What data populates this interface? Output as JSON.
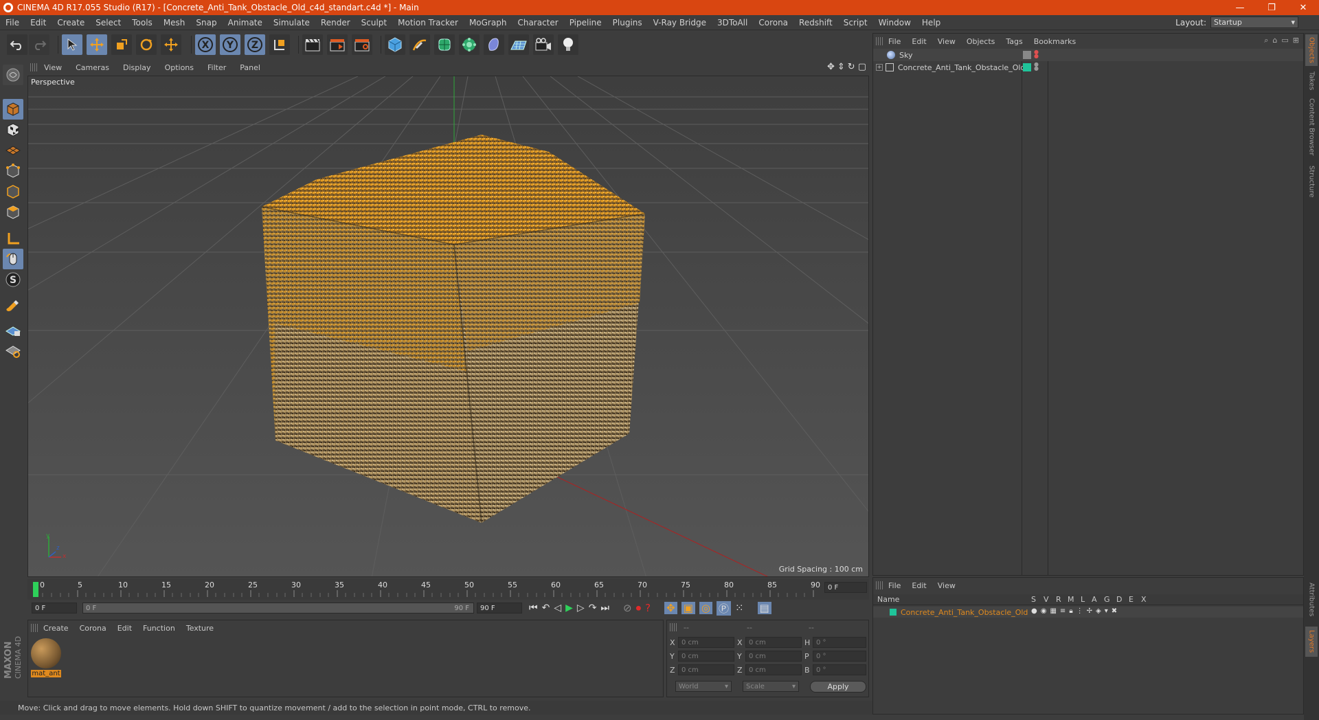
{
  "window": {
    "title": "CINEMA 4D R17.055 Studio (R17) - [Concrete_Anti_Tank_Obstacle_Old_c4d_standart.c4d *] - Main",
    "controls": [
      "—",
      "❐",
      "✕"
    ]
  },
  "menu": [
    "File",
    "Edit",
    "Create",
    "Select",
    "Tools",
    "Mesh",
    "Snap",
    "Animate",
    "Simulate",
    "Render",
    "Sculpt",
    "Motion Tracker",
    "MoGraph",
    "Character",
    "Pipeline",
    "Plugins",
    "V-Ray Bridge",
    "3DToAll",
    "Corona",
    "Redshift",
    "Script",
    "Window",
    "Help"
  ],
  "layout": {
    "label": "Layout:",
    "value": "Startup"
  },
  "viewport": {
    "menu": [
      "View",
      "Cameras",
      "Display",
      "Options",
      "Filter",
      "Panel"
    ],
    "label": "Perspective",
    "grid_spacing": "Grid Spacing : 100 cm",
    "axis": {
      "y": "y",
      "z": "z",
      "x": "x"
    }
  },
  "objects_panel": {
    "menu": [
      "File",
      "Edit",
      "View",
      "Objects",
      "Tags",
      "Bookmarks"
    ],
    "items": [
      {
        "name": "Sky"
      },
      {
        "name": "Concrete_Anti_Tank_Obstacle_Old"
      }
    ]
  },
  "side_tabs": [
    "Objects",
    "Takes",
    "Content Browser",
    "Structure",
    "Attributes",
    "Layers"
  ],
  "timeline": {
    "ticks": [
      "0",
      "5",
      "10",
      "15",
      "20",
      "25",
      "30",
      "35",
      "40",
      "45",
      "50",
      "55",
      "60",
      "65",
      "70",
      "75",
      "80",
      "85",
      "90"
    ],
    "current_frame": "0 F",
    "start": "0 F",
    "range_start": "0 F",
    "range_end": "90 F",
    "end": "90 F"
  },
  "material_panel": {
    "menu": [
      "Create",
      "Corona",
      "Edit",
      "Function",
      "Texture"
    ],
    "materials": [
      {
        "name": "mat_ant"
      }
    ]
  },
  "coord_panel": {
    "headers": [
      "--",
      "--",
      "--"
    ],
    "rows": [
      {
        "a": "X",
        "av": "0 cm",
        "b": "X",
        "bv": "0 cm",
        "c": "H",
        "cv": "0 °"
      },
      {
        "a": "Y",
        "av": "0 cm",
        "b": "Y",
        "bv": "0 cm",
        "c": "P",
        "cv": "0 °"
      },
      {
        "a": "Z",
        "av": "0 cm",
        "b": "Z",
        "bv": "0 cm",
        "c": "B",
        "cv": "0 °"
      }
    ],
    "mode1": "World",
    "mode2": "Scale",
    "apply": "Apply"
  },
  "layer_panel": {
    "menu": [
      "File",
      "Edit",
      "View"
    ],
    "columns": [
      "Name",
      "S",
      "V",
      "R",
      "M",
      "L",
      "A",
      "G",
      "D",
      "E",
      "X"
    ],
    "items": [
      {
        "name": "Concrete_Anti_Tank_Obstacle_Old"
      }
    ]
  },
  "status": "Move: Click and drag to move elements. Hold down SHIFT to quantize movement / add to the selection in point mode, CTRL to remove.",
  "brand": "MAXON CINEMA 4D",
  "colors": {
    "titlebar": "#d94611",
    "accent": "#e08a1e",
    "layer_green": "#1fc49a",
    "tool_blue": "#6b87b0"
  }
}
